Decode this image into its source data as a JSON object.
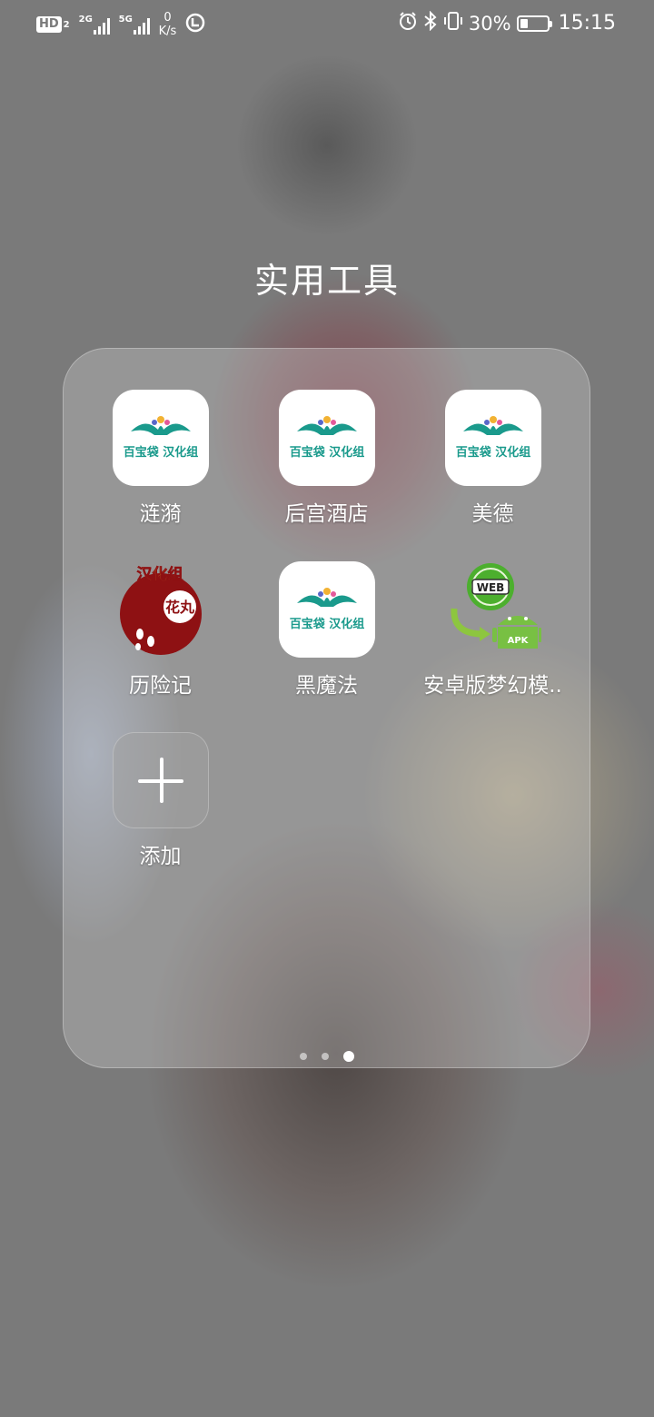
{
  "status_bar": {
    "hd": "HD",
    "hd_sub": "2",
    "signal1_type": "2G",
    "signal2_type": "5G",
    "net_speed_value": "0",
    "net_speed_unit": "K/s",
    "battery_percent_text": "30%",
    "battery_level": 0.3,
    "time": "15:15"
  },
  "folder": {
    "title": "实用工具",
    "apps": [
      {
        "label": "涟漪",
        "icon": "baibaodai-hanhuazu-logo",
        "icon_text": "百宝袋 汉化组"
      },
      {
        "label": "后宫酒店",
        "icon": "baibaodai-hanhuazu-logo",
        "icon_text": "百宝袋 汉化组"
      },
      {
        "label": "美德",
        "icon": "baibaodai-hanhuazu-logo",
        "icon_text": "百宝袋 汉化组"
      },
      {
        "label": "历险记",
        "icon": "hanhuazu-red-seal-logo",
        "icon_text": "汉化组",
        "icon_text2": "花丸"
      },
      {
        "label": "黑魔法",
        "icon": "baibaodai-hanhuazu-logo",
        "icon_text": "百宝袋 汉化组"
      },
      {
        "label": "安卓版梦幻模..",
        "icon": "web-to-apk-android-icon",
        "icon_text": "WEB",
        "icon_text2": "APK"
      }
    ],
    "add_label": "添加"
  },
  "pagination": {
    "pages": 3,
    "current": 3
  },
  "colors": {
    "brand_teal": "#1a9a8c",
    "seal_red": "#8e1113"
  }
}
